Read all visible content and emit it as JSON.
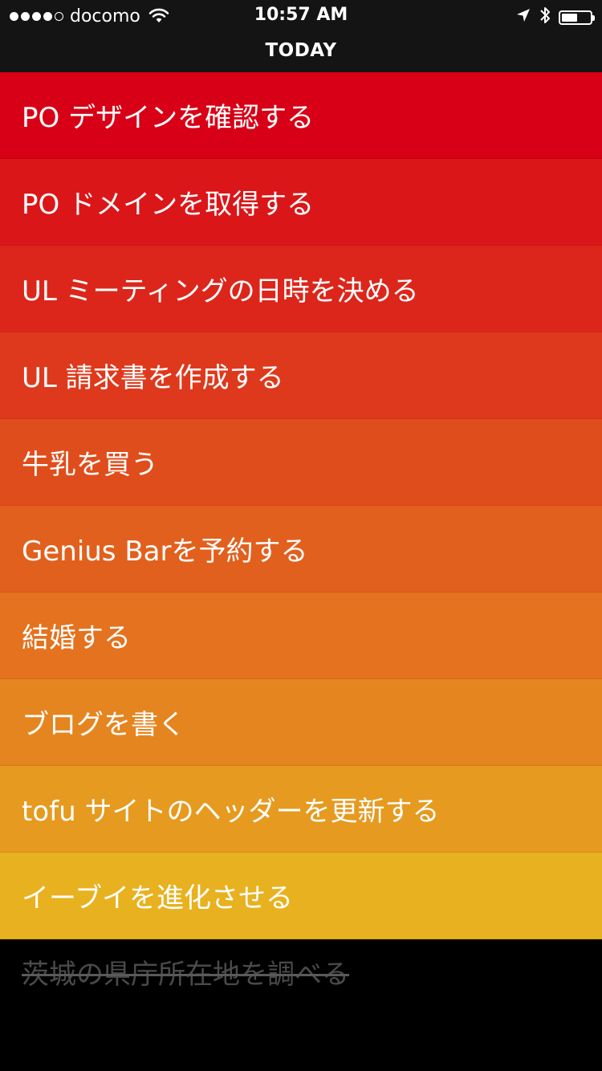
{
  "status_bar": {
    "carrier": "docomo",
    "time": "10:57 AM",
    "signal_bars_filled": 4,
    "signal_bars_total": 5,
    "battery_level": 0.55,
    "icons": [
      "wifi-icon",
      "location-arrow-icon",
      "bluetooth-icon",
      "battery-icon"
    ]
  },
  "nav": {
    "title": "TODAY"
  },
  "tasks": [
    {
      "label": "PO デザインを確認する",
      "color": "#d80016"
    },
    {
      "label": "PO ドメインを取得する",
      "color": "#db1619"
    },
    {
      "label": "UL ミーティングの日時を決める",
      "color": "#dc261b"
    },
    {
      "label": "UL 請求書を作成する",
      "color": "#de391c"
    },
    {
      "label": "牛乳を買う",
      "color": "#e04d1c"
    },
    {
      "label": "Genius Barを予約する",
      "color": "#e2601d"
    },
    {
      "label": "結婚する",
      "color": "#e4721e"
    },
    {
      "label": "ブログを書く",
      "color": "#e5851f"
    },
    {
      "label": "tofu サイトのヘッダーを更新する",
      "color": "#e69a1f"
    },
    {
      "label": "イーブイを進化させる",
      "color": "#e8b11f"
    }
  ],
  "completed_tasks": [
    {
      "label": "茨城の県庁所在地を調べる"
    }
  ]
}
